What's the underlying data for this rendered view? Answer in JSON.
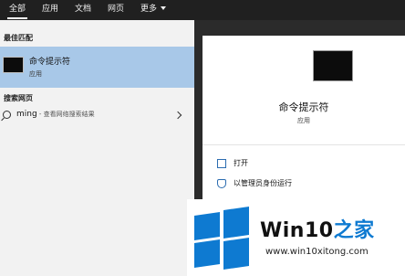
{
  "tabs": [
    {
      "label": "全部",
      "active": true
    },
    {
      "label": "应用"
    },
    {
      "label": "文档"
    },
    {
      "label": "网页"
    },
    {
      "label": "更多"
    }
  ],
  "sections": {
    "best_match": "最佳匹配",
    "search_web": "搜索网页"
  },
  "best_result": {
    "title": "命令提示符",
    "subtitle": "应用"
  },
  "web_result": {
    "query": "ming",
    "suffix": " - 查看网络搜索结果"
  },
  "preview": {
    "title": "命令提示符",
    "subtitle": "应用",
    "actions": [
      {
        "label": "打开",
        "icon": "open-icon"
      },
      {
        "label": "以管理员身份运行",
        "icon": "shield-icon"
      },
      {
        "label": "",
        "icon": "location-icon"
      }
    ]
  },
  "watermark": {
    "brand": "Win10",
    "brand_suffix": "之家",
    "url": "www.win10xitong.com"
  },
  "colors": {
    "selection": "#a8c8e8",
    "topbar": "#202020",
    "accent": "#0e7ad1"
  }
}
